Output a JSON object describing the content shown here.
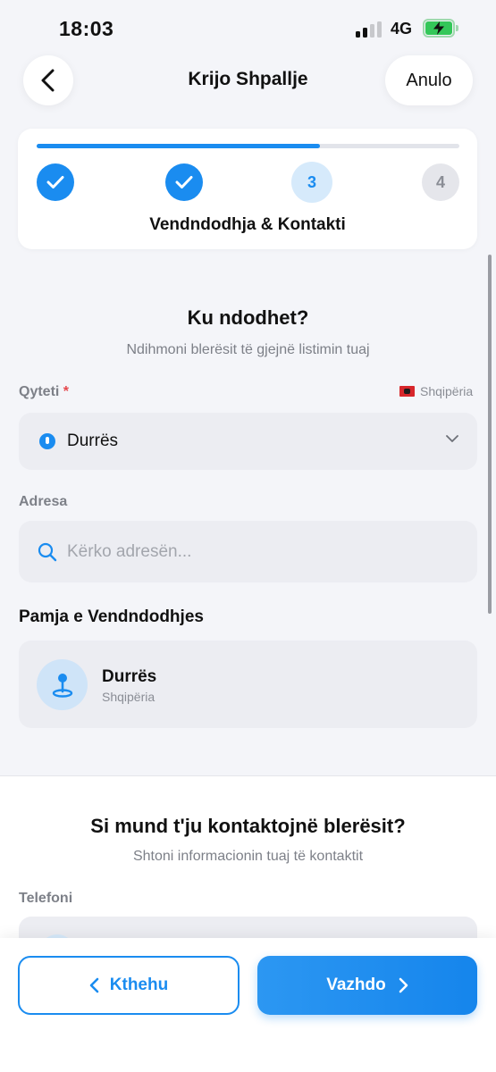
{
  "status_bar": {
    "time": "18:03",
    "network": "4G"
  },
  "header": {
    "title": "Krijo Shpallje",
    "cancel_label": "Anulo"
  },
  "stepper": {
    "progress": 0.67,
    "steps": [
      {
        "state": "done",
        "label": ""
      },
      {
        "state": "done",
        "label": ""
      },
      {
        "state": "current",
        "label": "3"
      },
      {
        "state": "pending",
        "label": "4"
      }
    ],
    "current_title": "Vendndodhja & Kontakti"
  },
  "location": {
    "title": "Ku ndodhet?",
    "subtitle": "Ndihmoni blerësit të gjejnë listimin tuaj",
    "city_label": "Qyteti",
    "required_mark": "*",
    "country_tag": "Shqipëria",
    "city_value": "Durrës",
    "address_label": "Adresa",
    "address_placeholder": "Kërko adresën...",
    "address_value": "",
    "preview_title": "Pamja e Vendndodhjes",
    "preview_city": "Durrës",
    "preview_country": "Shqipëria"
  },
  "contact": {
    "title": "Si mund t'ju kontaktojnë blerësit?",
    "subtitle": "Shtoni informacionin tuaj të kontaktit",
    "phone_label": "Telefoni"
  },
  "footer": {
    "back_label": "Kthehu",
    "next_label": "Vazhdo"
  },
  "colors": {
    "accent": "#1a8cf0",
    "required": "#e5484d"
  }
}
